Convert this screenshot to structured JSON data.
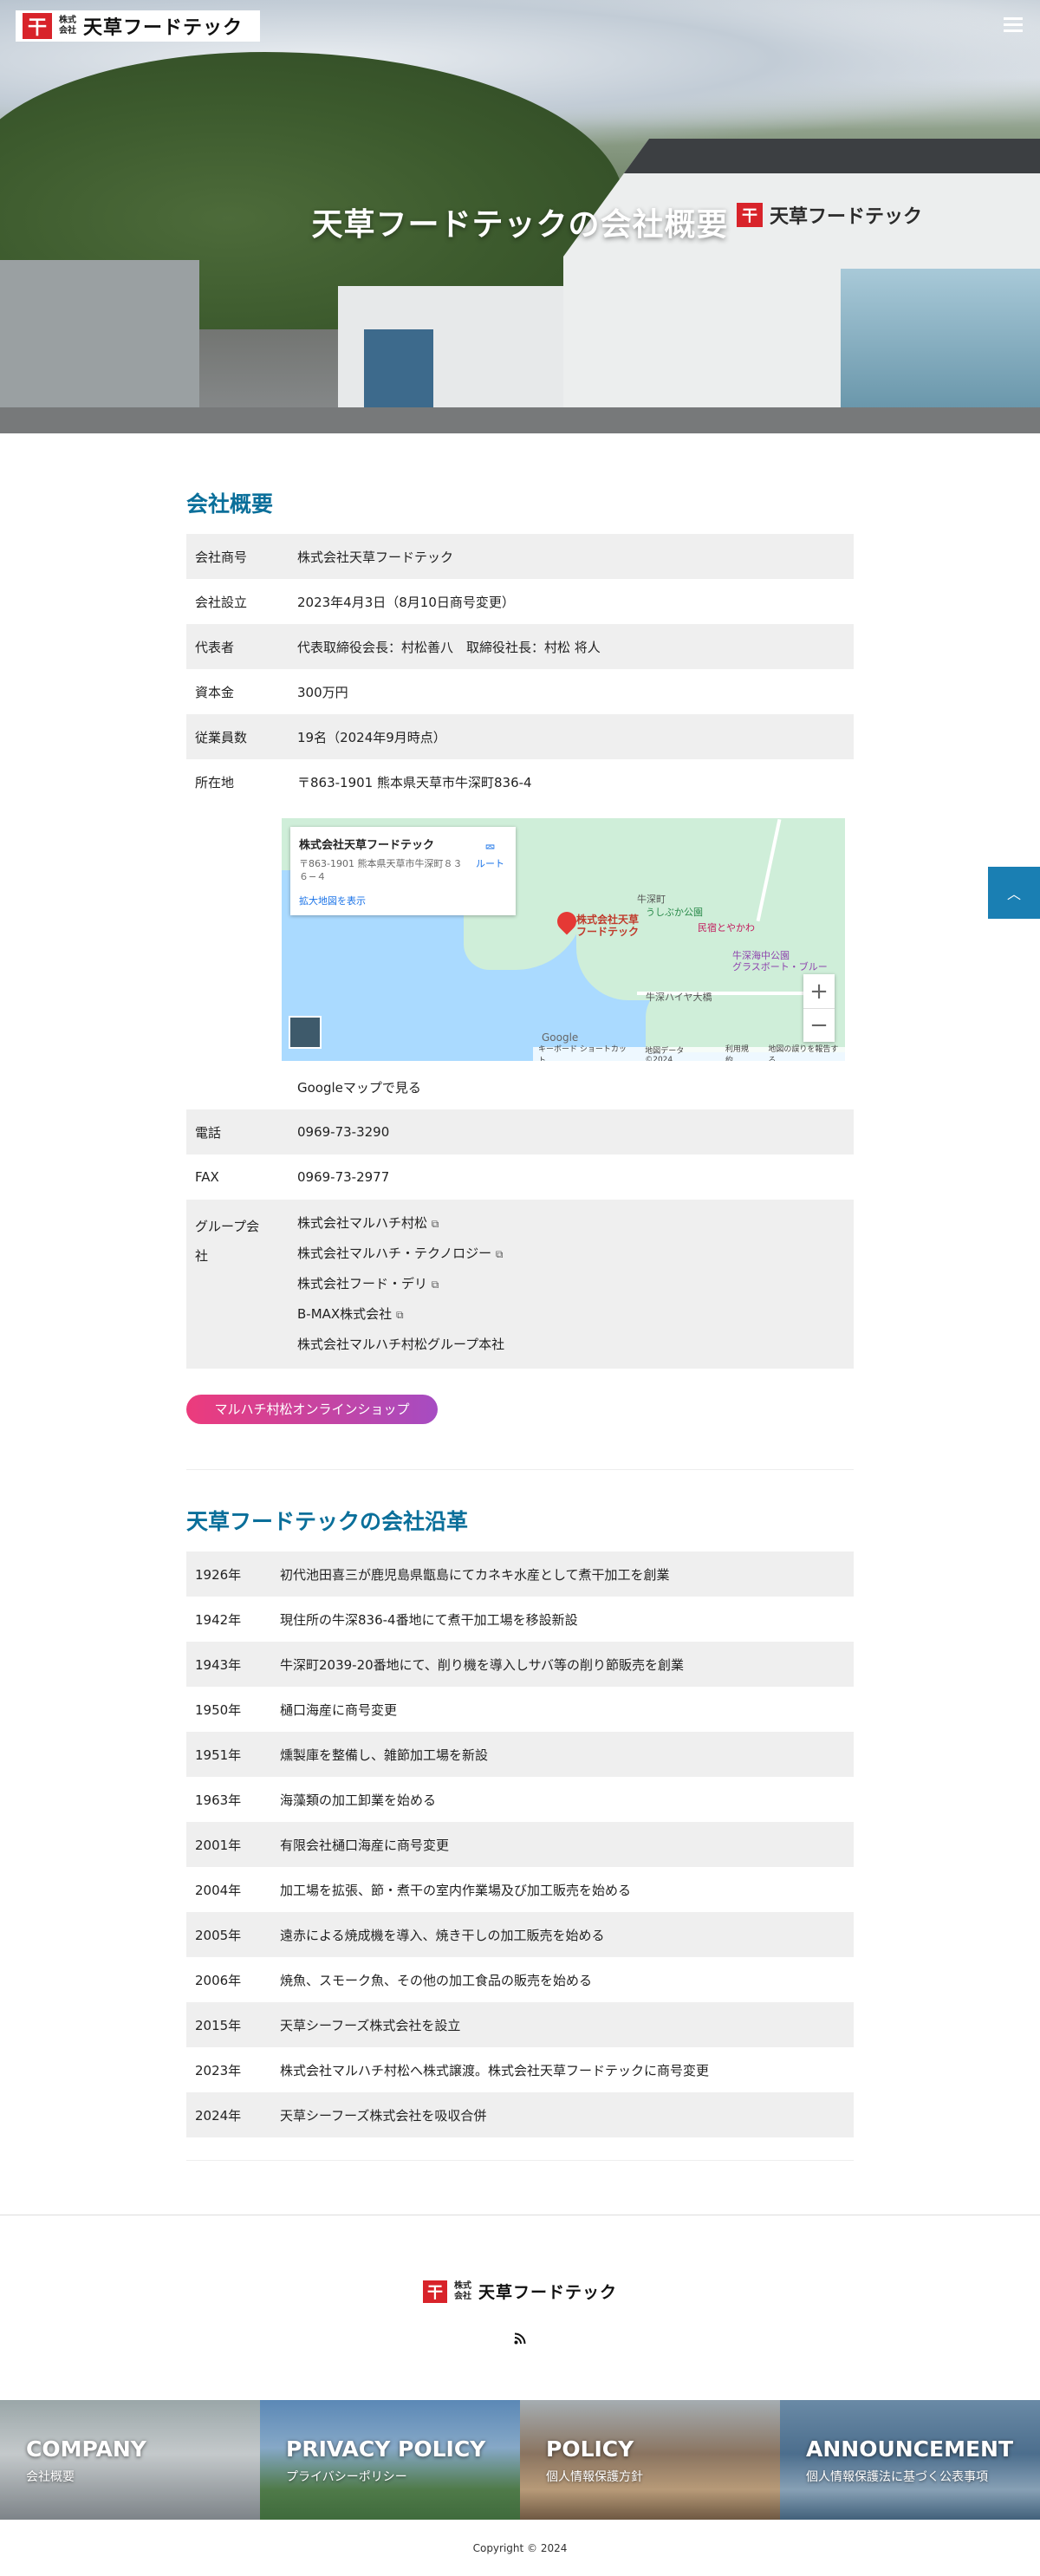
{
  "header": {
    "logo_mark": "干",
    "logo_kabu_1": "株式",
    "logo_kabu_2": "会社",
    "logo_name": "天草フードテック"
  },
  "hero": {
    "title": "天草フードテックの会社概要",
    "sign_text": "天草フードテック"
  },
  "overview": {
    "title": "会社概要",
    "rows": [
      {
        "label": "会社商号",
        "value": "株式会社天草フードテック"
      },
      {
        "label": "会社設立",
        "value": "2023年4月3日（8月10日商号変更）"
      },
      {
        "label": "代表者",
        "value": "代表取締役会長：村松善八　取締役社長：村松 将人"
      },
      {
        "label": "資本金",
        "value": "300万円"
      },
      {
        "label": "従業員数",
        "value": "19名（2024年9月時点）"
      },
      {
        "label": "所在地",
        "value": "〒863-1901 熊本県天草市牛深町836-4"
      }
    ],
    "map": {
      "card_name": "株式会社天草フードテック",
      "card_addr": "〒863-1901 熊本県天草市牛深町８３６−４",
      "route": "ルート",
      "enlarge": "拡大地図を表示",
      "pin_label_1": "株式会社天草",
      "pin_label_2": "フードテック",
      "label_ushibuka": "牛深町",
      "label_park": "うしぶか公園",
      "label_minshuku": "民宿とやかわ",
      "label_kaichu": "牛深海中公園",
      "label_glass": "グラスボート・ブルー",
      "label_haiya": "牛深ハイヤ大橋",
      "google": "Google",
      "footer_1": "キーボード ショートカット",
      "footer_2": "地図データ ©2024",
      "footer_3": "利用規約",
      "footer_4": "地図の誤りを報告する",
      "zoom_in": "+",
      "zoom_out": "−"
    },
    "map_link": "Googleマップで見る",
    "tel_label": "電話",
    "tel": "0969-73-3290",
    "fax_label": "FAX",
    "fax": "0969-73-2977",
    "group_label": "グループ会社",
    "group": [
      "株式会社マルハチ村松",
      "株式会社マルハチ・テクノロジー",
      "株式会社フード・デリ",
      "B-MAX株式会社",
      "株式会社マルハチ村松グループ本社"
    ],
    "shop_button": "マルハチ村松オンラインショップ"
  },
  "history": {
    "title": "天草フードテックの会社沿革",
    "rows": [
      {
        "year": "1926年",
        "text": "初代池田喜三が鹿児島県甑島にてカネキ水産として煮干加工を創業"
      },
      {
        "year": "1942年",
        "text": "現住所の牛深836-4番地にて煮干加工場を移設新設"
      },
      {
        "year": "1943年",
        "text": "牛深町2039-20番地にて、削り機を導入しサバ等の削り節販売を創業"
      },
      {
        "year": "1950年",
        "text": "樋口海産に商号変更"
      },
      {
        "year": "1951年",
        "text": "燻製庫を整備し、雑節加工場を新設"
      },
      {
        "year": "1963年",
        "text": "海藻類の加工卸業を始める"
      },
      {
        "year": "2001年",
        "text": "有限会社樋口海産に商号変更"
      },
      {
        "year": "2004年",
        "text": "加工場を拡張、節・煮干の室内作業場及び加工販売を始める"
      },
      {
        "year": "2005年",
        "text": "遠赤による焼成機を導入、焼き干しの加工販売を始める"
      },
      {
        "year": "2006年",
        "text": "焼魚、スモーク魚、その他の加工食品の販売を始める"
      },
      {
        "year": "2015年",
        "text": "天草シーフーズ株式会社を設立"
      },
      {
        "year": "2023年",
        "text": "株式会社マルハチ村松へ株式譲渡。株式会社天草フードテックに商号変更"
      },
      {
        "year": "2024年",
        "text": "天草シーフーズ株式会社を吸収合併"
      }
    ]
  },
  "footer": {
    "rss_icon": "rss-icon",
    "tiles": [
      {
        "en": "COMPANY",
        "jp": "会社概要"
      },
      {
        "en": "PRIVACY POLICY",
        "jp": "プライバシーポリシー"
      },
      {
        "en": "POLICY",
        "jp": "個人情報保護方針"
      },
      {
        "en": "ANNOUNCEMENT",
        "jp": "個人情報保護法に基づく公表事項"
      }
    ],
    "copyright": "Copyright © 2024"
  },
  "colors": {
    "accent": "#0a6f9a",
    "brand_red": "#d8232a",
    "to_top": "#1a7fb3"
  }
}
